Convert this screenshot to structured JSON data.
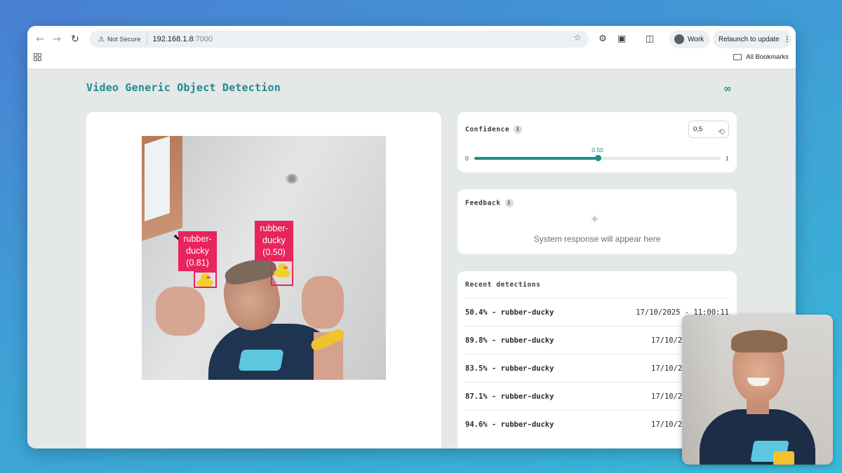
{
  "browser": {
    "security_badge": "Not Secure",
    "url_host": "192.168.1.8",
    "url_port": ":7000",
    "profile": "Work",
    "relaunch_label": "Relaunch to update",
    "bookmarks_label": "All Bookmarks"
  },
  "page": {
    "title": "Video Generic Object Detection"
  },
  "video": {
    "detections": [
      {
        "label_line1": "rubber-",
        "label_line2": "ducky",
        "score": "(0.81)"
      },
      {
        "label_line1": "rubber-",
        "label_line2": "ducky",
        "score": "(0.50)"
      }
    ]
  },
  "confidence": {
    "title": "Confidence",
    "input_value": "0,5",
    "slider_value_label": "0.50",
    "slider_value": 0.5,
    "min_label": "0",
    "max_label": "1"
  },
  "feedback": {
    "title": "Feedback",
    "empty_message": "System response will appear here"
  },
  "recent": {
    "title": "Recent detections",
    "rows": [
      {
        "what": "50.4% - rubber-ducky",
        "when": "17/10/2025 - 11:00:11"
      },
      {
        "what": "89.8% - rubber-ducky",
        "when": "17/10/20"
      },
      {
        "what": "83.5% - rubber-ducky",
        "when": "17/10/20"
      },
      {
        "what": "87.1% - rubber-ducky",
        "when": "17/10/20"
      },
      {
        "what": "94.6% - rubber-ducky",
        "when": "17/10/20"
      }
    ]
  },
  "colors": {
    "accent": "#1f8c90",
    "detection": "#e8245d"
  }
}
